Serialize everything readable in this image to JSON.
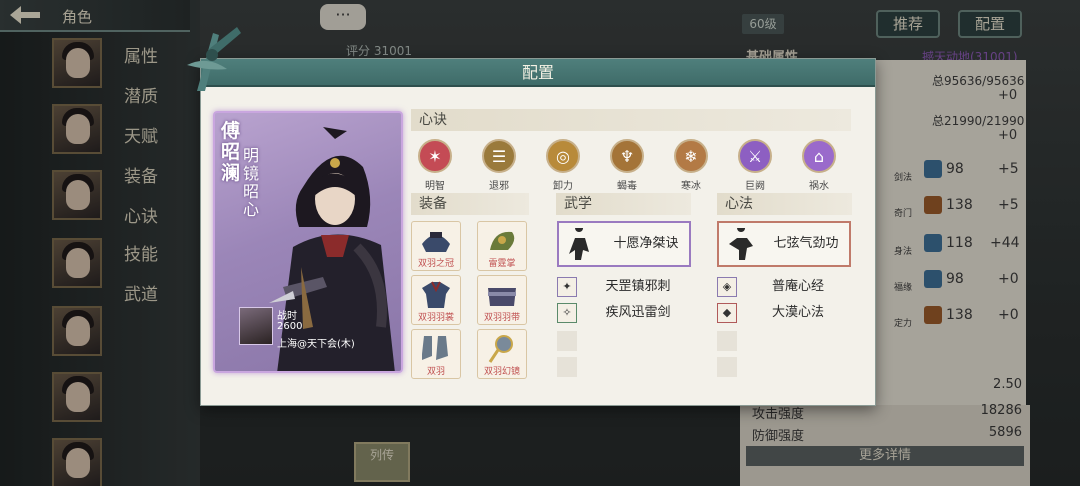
{
  "background": {
    "header_title": "角色",
    "nav": [
      "属性",
      "潜质",
      "天赋",
      "装备",
      "心诀",
      "技能",
      "武道"
    ],
    "level_badge": "60级",
    "recommend_button": "推荐",
    "config_button": "配置",
    "score_label": "评分",
    "score_value": "31001",
    "base_attr_label": "基础属性",
    "base_attr_value": "撼天动地(31001)",
    "stat_total_1": "总95636/95636",
    "stat_plus_1": "+0",
    "stat_total_2": "总21990/21990",
    "stat_plus_2": "+0",
    "rows": [
      {
        "label": "剑法",
        "value": "98",
        "plus": "+5"
      },
      {
        "label": "奇门",
        "value": "138",
        "plus": "+5"
      },
      {
        "label": "身法",
        "value": "118",
        "plus": "+44"
      },
      {
        "label": "福缘",
        "value": "98",
        "plus": "+0"
      },
      {
        "label": "定力",
        "value": "138",
        "plus": "+0"
      }
    ],
    "bottom_value_1": "2.50",
    "attack_label": "攻击强度",
    "attack_value": "18286",
    "defense_label": "防御强度",
    "defense_value": "5896",
    "more_details": "更多详情",
    "chat_icon": "···",
    "bio_button": "列传"
  },
  "modal": {
    "title": "配置",
    "character": {
      "name": "傅昭澜",
      "title": "明镜昭心",
      "player_name": "战时",
      "player_score": "2600",
      "player_server": "上海@天下会(木)"
    },
    "xinjue_header": "心诀",
    "xinjue": [
      {
        "name": "明智",
        "color": "#c44b55"
      },
      {
        "name": "退邪",
        "color": "#9a7a3c"
      },
      {
        "name": "卸力",
        "color": "#b88a3a"
      },
      {
        "name": "蝎毒",
        "color": "#a47438"
      },
      {
        "name": "寒冰",
        "color": "#b37a45"
      },
      {
        "name": "巨阙",
        "color": "#8d5fc2"
      },
      {
        "name": "祸水",
        "color": "#9a6acb"
      }
    ],
    "equip_header": "装备",
    "equipment": [
      "双羽之冠",
      "雷霆掌",
      "双羽羽裳",
      "双羽羽带",
      "双羽",
      "双羽幻镜"
    ],
    "wuxue_header": "武学",
    "wuxue_main": "十愿净桀诀",
    "wuxue_subs": [
      "天罡镇邪刺",
      "疾风迅雷剑"
    ],
    "xinfa_header": "心法",
    "xinfa_main": "七弦气劲功",
    "xinfa_subs": [
      "普庵心经",
      "大漠心法"
    ]
  }
}
